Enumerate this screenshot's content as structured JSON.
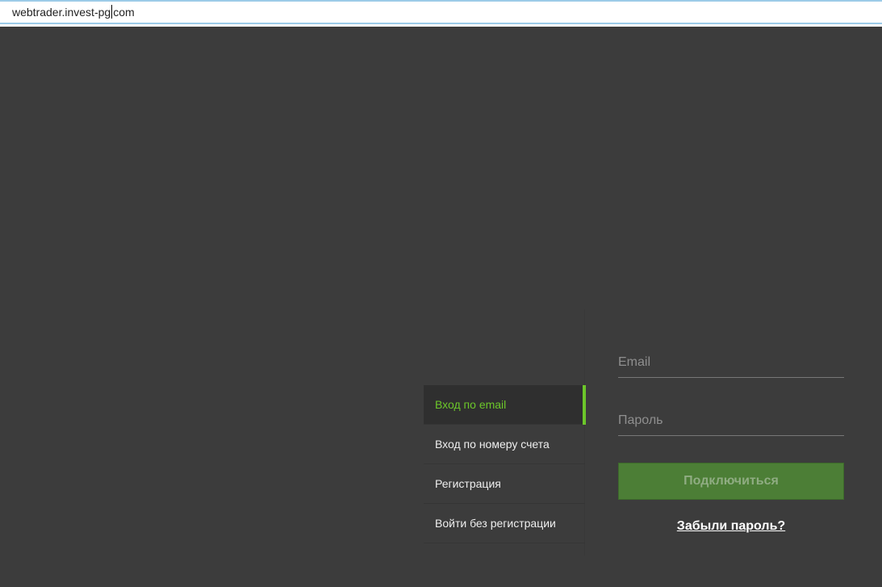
{
  "browser": {
    "url_before_caret": "webtrader.invest-pg",
    "url_after_caret": "com"
  },
  "menu": {
    "items": [
      {
        "label": "Вход по email",
        "active": true
      },
      {
        "label": "Вход по номеру счета"
      },
      {
        "label": "Регистрация"
      },
      {
        "label": "Войти без регистрации"
      }
    ]
  },
  "form": {
    "email_placeholder": "Email",
    "password_placeholder": "Пароль",
    "submit_label": "Подключиться",
    "forgot_label": "Забыли пароль?"
  },
  "colors": {
    "accent": "#6cc72a",
    "button": "#4c7e36",
    "background": "#3c3c3c"
  }
}
